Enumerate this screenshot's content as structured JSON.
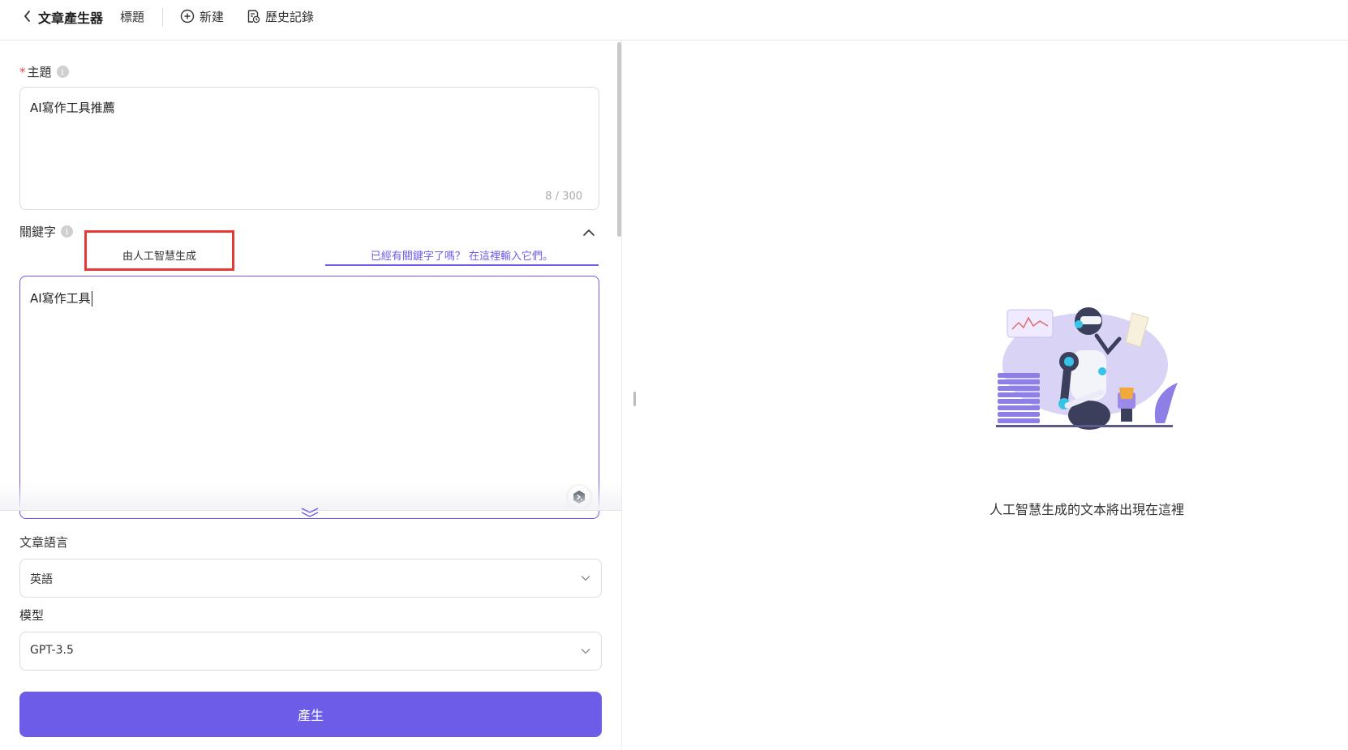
{
  "header": {
    "app_title": "文章產生器",
    "breadcrumb": "標題",
    "new_label": "新建",
    "history_label": "歷史記錄"
  },
  "form": {
    "topic": {
      "label": "主題",
      "required_mark": "*",
      "info_glyph": "i",
      "value": "AI寫作工具推薦",
      "counter": "8 / 300"
    },
    "keywords": {
      "label": "關鍵字",
      "info_glyph": "i",
      "tab_ai": "由人工智慧生成",
      "tab_manual": "已經有關鍵字了嗎？ 在這裡輸入它們。",
      "value": "AI寫作工具"
    },
    "language": {
      "label": "文章語言",
      "selected": "英語"
    },
    "model": {
      "label": "模型",
      "selected": "GPT-3.5"
    },
    "generate_label": "產生"
  },
  "output": {
    "placeholder": "人工智慧生成的文本將出現在這裡"
  },
  "colors": {
    "accent": "#6c5ce7",
    "highlight_border": "#e53935"
  }
}
